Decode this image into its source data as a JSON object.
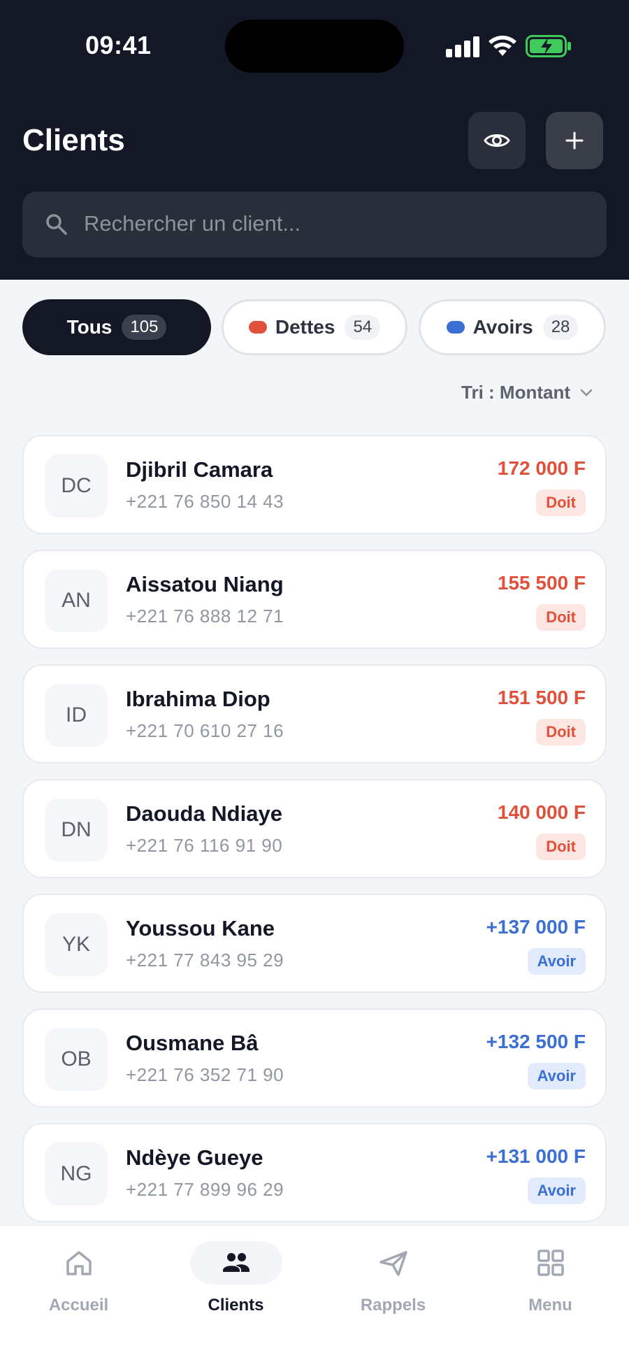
{
  "status_bar": {
    "time": "09:41"
  },
  "header": {
    "title": "Clients",
    "eye_icon": "eye-icon",
    "add_icon": "plus-icon",
    "search_placeholder": "Rechercher un client..."
  },
  "filters": [
    {
      "label": "Tous",
      "count": "105"
    },
    {
      "label": "Dettes",
      "count": "54",
      "dot_color": "#e0503a"
    },
    {
      "label": "Avoirs",
      "count": "28",
      "dot_color": "#3b6fd4"
    }
  ],
  "sort": {
    "label": "Tri : Montant"
  },
  "clients": [
    {
      "initials": "DC",
      "name": "Djibril Camara",
      "phone": "+221 76 850 14 43",
      "amount": "172 000 F",
      "status": "Doit",
      "kind": "debt"
    },
    {
      "initials": "AN",
      "name": "Aissatou Niang",
      "phone": "+221 76 888 12 71",
      "amount": "155 500 F",
      "status": "Doit",
      "kind": "debt"
    },
    {
      "initials": "ID",
      "name": "Ibrahima Diop",
      "phone": "+221 70 610 27 16",
      "amount": "151 500 F",
      "status": "Doit",
      "kind": "debt"
    },
    {
      "initials": "DN",
      "name": "Daouda Ndiaye",
      "phone": "+221 76 116 91 90",
      "amount": "140 000 F",
      "status": "Doit",
      "kind": "debt"
    },
    {
      "initials": "YK",
      "name": "Youssou Kane",
      "phone": "+221 77 843 95 29",
      "amount": "+137 000 F",
      "status": "Avoir",
      "kind": "credit"
    },
    {
      "initials": "OB",
      "name": "Ousmane Bâ",
      "phone": "+221 76 352 71 90",
      "amount": "+132 500 F",
      "status": "Avoir",
      "kind": "credit"
    },
    {
      "initials": "NG",
      "name": "Ndèye Gueye",
      "phone": "+221 77 899 96 29",
      "amount": "+131 000 F",
      "status": "Avoir",
      "kind": "credit"
    }
  ],
  "bottom_nav": [
    {
      "label": "Accueil",
      "icon": "home-icon"
    },
    {
      "label": "Clients",
      "icon": "users-icon",
      "active": true
    },
    {
      "label": "Rappels",
      "icon": "send-icon"
    },
    {
      "label": "Menu",
      "icon": "grid-icon"
    }
  ],
  "colors": {
    "header_bg": "#131726",
    "debt": "#e0503a",
    "credit": "#3b6fd4"
  }
}
